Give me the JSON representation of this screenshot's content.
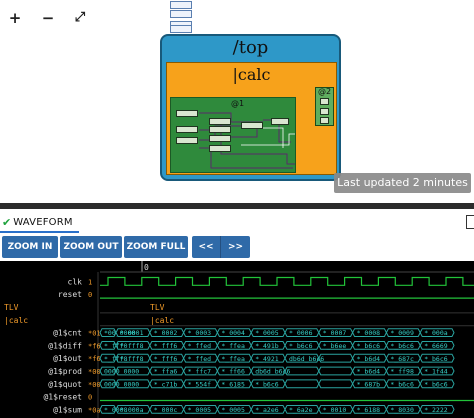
{
  "diagram": {
    "zoom_controls": {
      "zoom_in": "+",
      "zoom_out": "−",
      "fit": "⤢"
    },
    "mini_boxes": [
      "",
      "",
      "",
      ""
    ],
    "top_module": {
      "title": "/top"
    },
    "calc_module": {
      "title": "|calc"
    },
    "logic_stage": {
      "label": "@1"
    },
    "output_stage": {
      "label": "@2"
    },
    "last_updated": "Last updated 2 minutes ago"
  },
  "tabs": {
    "waveform": "WAVEFORM"
  },
  "toolbar": {
    "zoom_in": "ZOOM IN",
    "zoom_out": "ZOOM OUT",
    "zoom_full": "ZOOM FULL",
    "prev": "<<",
    "next": ">>"
  },
  "waveform": {
    "time_marker": "0",
    "colors": {
      "bit": "#22c33a",
      "vector": "#2aa4a0",
      "text": "#dddddd",
      "scope": "#f09a2a",
      "value": "#36d0c8"
    },
    "signals": [
      {
        "name": "clk",
        "kind": "clock",
        "value": "1"
      },
      {
        "name": "reset",
        "kind": "low",
        "value": "0"
      },
      {
        "name": "TLV",
        "kind": "scope",
        "value": "",
        "scope_label": "TLV"
      },
      {
        "name": "|calc",
        "kind": "scope",
        "value": "",
        "scope_label": "|calc"
      },
      {
        "name": "@1$cnt",
        "kind": "vector",
        "value": "*01",
        "cells": [
          "*00_0000",
          "*_0001",
          "*_0002",
          "*_0003",
          "*_0004",
          "*_0005",
          "*_0006",
          "*_0007",
          "*_0008",
          "*_0009",
          "*_000a"
        ]
      },
      {
        "name": "@1$diff",
        "kind": "vector",
        "value": "*f6",
        "cells": [
          "*_fff0",
          "*_fff8",
          "*_fff6",
          "*_ffed",
          "*_ffea",
          "*_491b",
          "*_b6c6",
          "*_b6ee",
          "*_b6c6",
          "*_b6c6",
          "*_6669"
        ]
      },
      {
        "name": "@1$out",
        "kind": "vector",
        "value": "*f6",
        "cells": [
          "*_fff8",
          "*_fff8",
          "*_fff6",
          "*_ffed",
          "*_ffea",
          "*_4921",
          "db6d_b6c6",
          "",
          "*_b6d4",
          "*_687c",
          "*_b6c6"
        ]
      },
      {
        "name": "@1$prod",
        "kind": "vector",
        "value": "*00",
        "cells": [
          "0000_0000",
          "",
          "*_ffa6",
          "*_ffc7",
          "*_ff66",
          "db6d_b6c6",
          "",
          "",
          "*_b6d4",
          "*_ff98",
          "*_1f44"
        ]
      },
      {
        "name": "@1$quot",
        "kind": "vector",
        "value": "*00",
        "cells": [
          "0000_0000",
          "",
          "*_c71b",
          "*_554f",
          "*_6185",
          "*_b6c6",
          "",
          "",
          "*_687b",
          "*_b6c6",
          "*_b6c6"
        ]
      },
      {
        "name": "@1$reset",
        "kind": "low",
        "value": "0"
      },
      {
        "name": "@1$sum",
        "kind": "vector",
        "value": "*0a",
        "cells": [
          "*_0008",
          "*_000a",
          "*_000c",
          "*_0005",
          "*_0005",
          "*_a2e6",
          "*_6a2e",
          "*_0010",
          "*_6188",
          "*_8030",
          "*_2222"
        ]
      }
    ]
  }
}
